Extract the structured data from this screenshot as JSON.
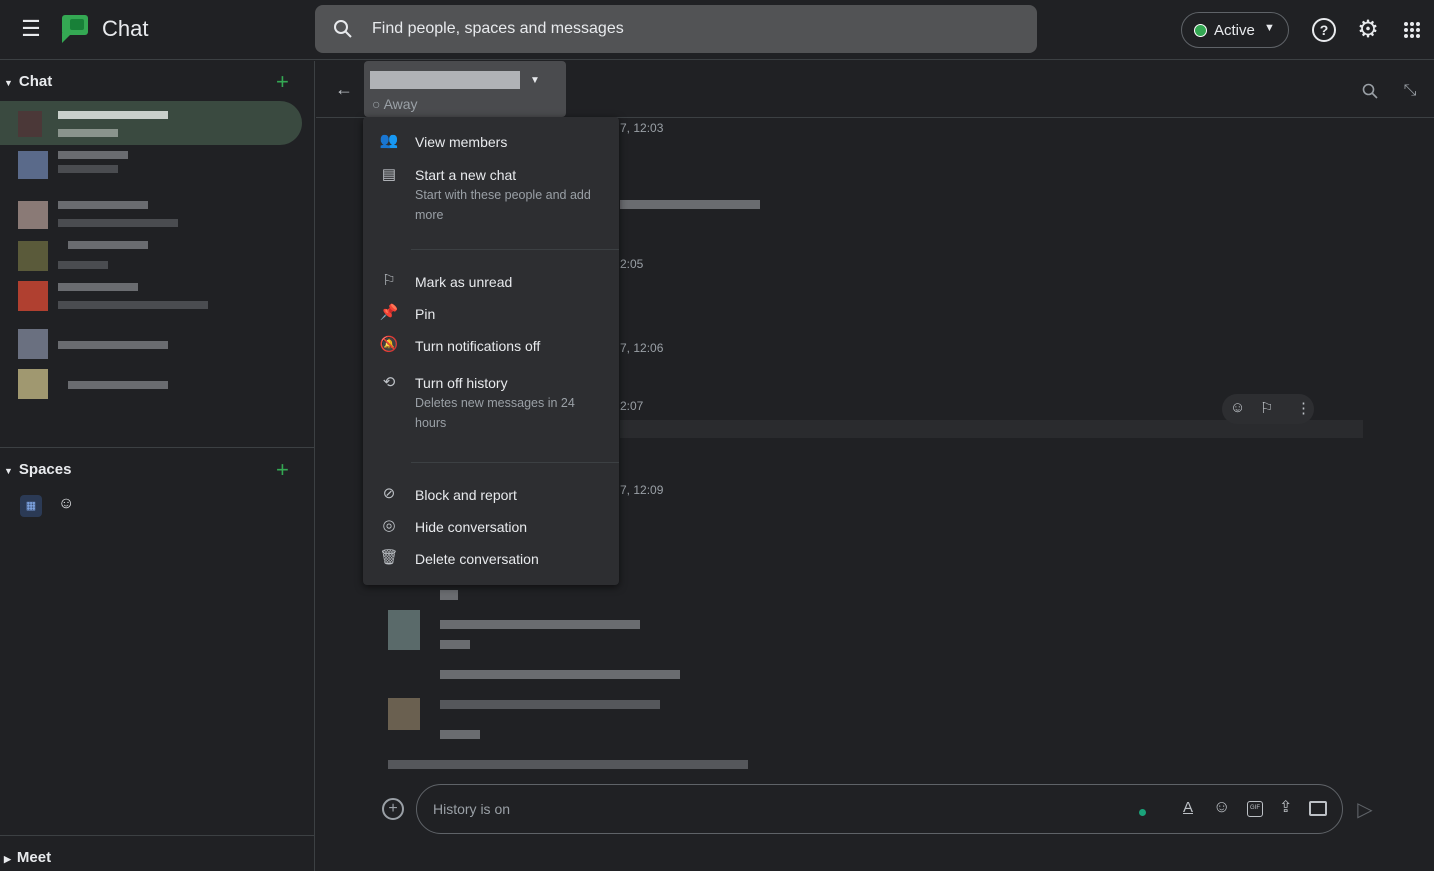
{
  "app": {
    "title": "Chat",
    "logo_color": "#34a853"
  },
  "search": {
    "placeholder": "Find people, spaces and messages"
  },
  "status": {
    "label": "Active",
    "color": "#34a853"
  },
  "sidebar": {
    "chat_label": "Chat",
    "spaces_label": "Spaces",
    "meet_label": "Meet"
  },
  "conversation": {
    "presence": "Away"
  },
  "menu": {
    "items": [
      {
        "label": "View members",
        "icon": "people-icon"
      },
      {
        "label": "Start a new chat",
        "sub": "Start with these people and add more",
        "icon": "chat-icon"
      },
      {
        "label": "Mark as unread",
        "icon": "mark-unread-icon"
      },
      {
        "label": "Pin",
        "icon": "pin-icon"
      },
      {
        "label": "Turn notifications off",
        "icon": "bell-off-icon"
      },
      {
        "label": "Turn off history",
        "sub": "Deletes new messages in 24 hours",
        "icon": "history-off-icon"
      },
      {
        "label": "Block and report",
        "icon": "block-icon"
      },
      {
        "label": "Hide conversation",
        "icon": "eye-off-icon"
      },
      {
        "label": "Delete conversation",
        "icon": "trash-icon"
      }
    ]
  },
  "timestamps": [
    "7, 12:03",
    "2:05",
    "7, 12:06",
    "2:07",
    "7, 12:09"
  ],
  "composer": {
    "placeholder": "History is on"
  }
}
